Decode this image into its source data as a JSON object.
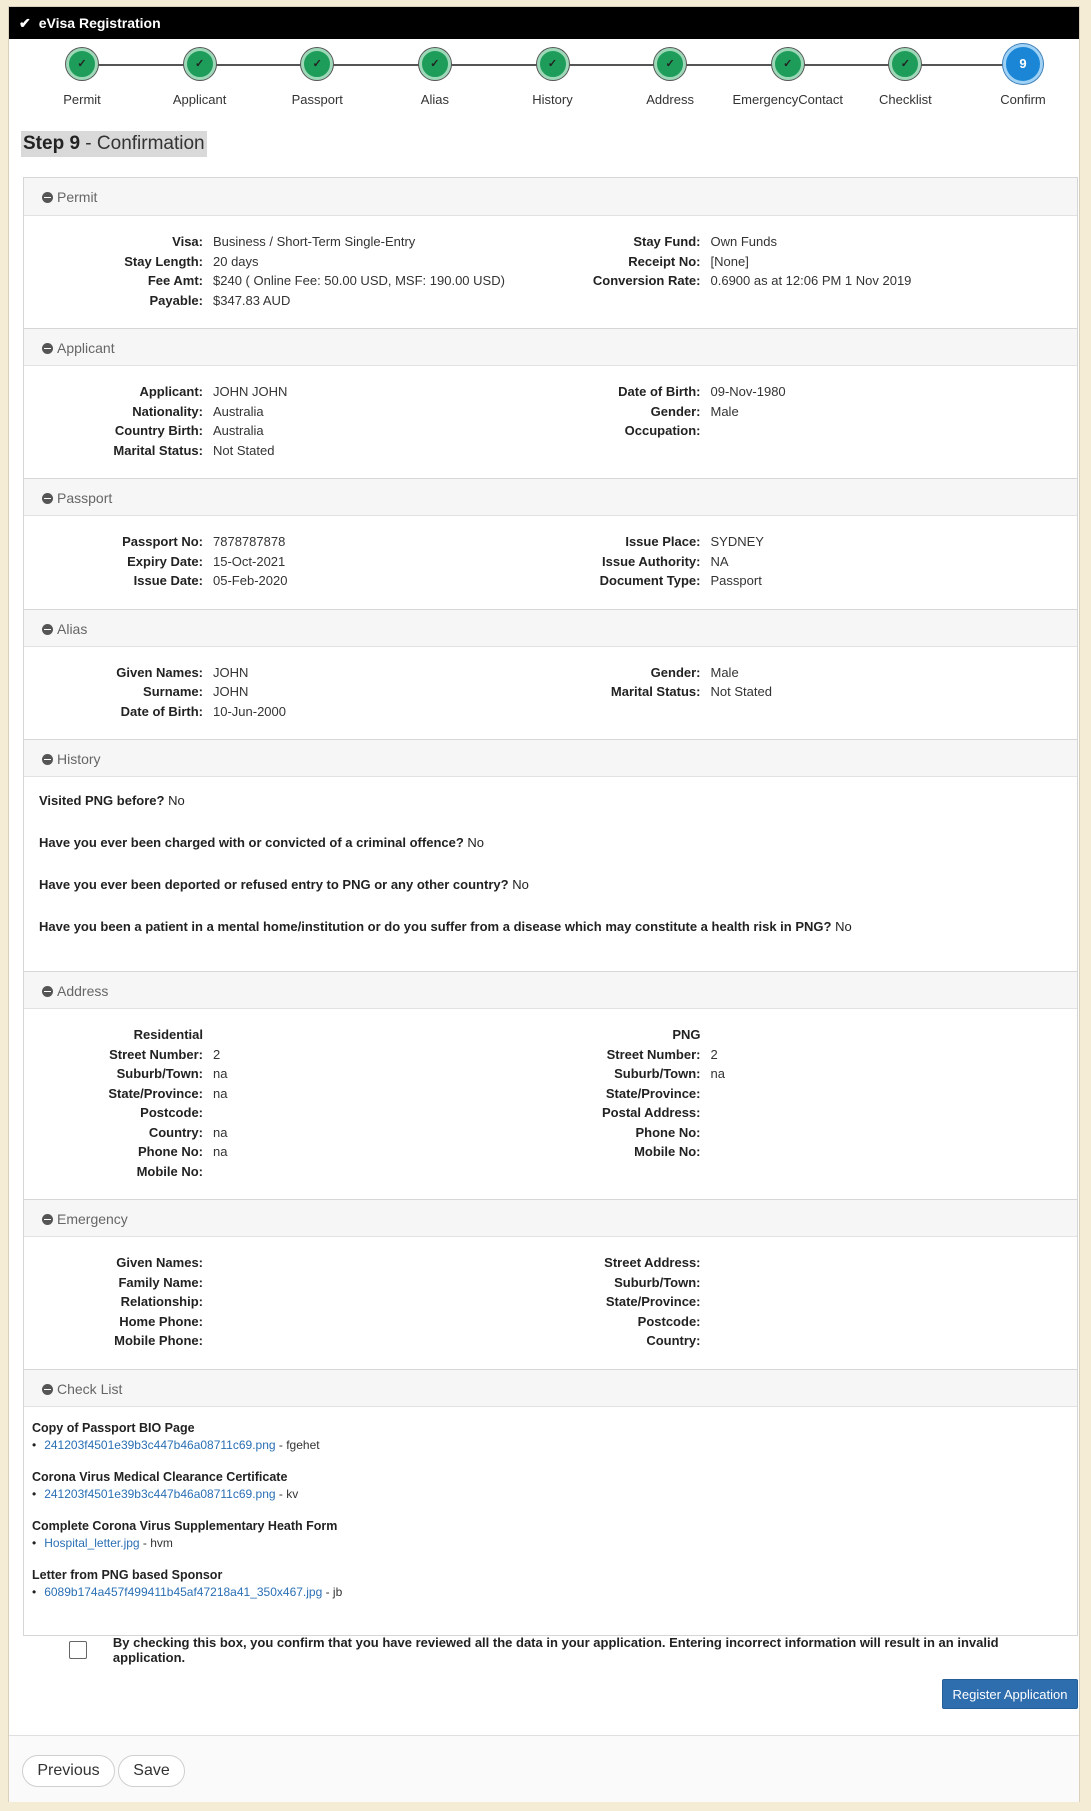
{
  "window": {
    "title": "eVisa Registration"
  },
  "stepper": {
    "steps": [
      "Permit",
      "Applicant",
      "Passport",
      "Alias",
      "History",
      "Address",
      "EmergencyContact",
      "Checklist",
      "Confirm"
    ],
    "current_number": "9",
    "check_glyph": "✓"
  },
  "step_heading": {
    "prefix": "Step 9",
    "title": " - Confirmation"
  },
  "permit": {
    "title": "Permit",
    "left": [
      {
        "k": "Visa:",
        "v": "Business / Short-Term Single-Entry"
      },
      {
        "k": "Stay Length:",
        "v": "20 days"
      },
      {
        "k": "Fee Amt:",
        "v": "$240 ( Online Fee: 50.00 USD, MSF: 190.00 USD)"
      },
      {
        "k": "Payable:",
        "v": "$347.83 AUD"
      }
    ],
    "right": [
      {
        "k": "Stay Fund:",
        "v": "Own Funds"
      },
      {
        "k": "Receipt No:",
        "v": "[None]"
      },
      {
        "k": "Conversion Rate:",
        "v": "0.6900 as at 12:06 PM 1 Nov 2019"
      }
    ]
  },
  "applicant": {
    "title": "Applicant",
    "left": [
      {
        "k": "Applicant:",
        "v": "JOHN JOHN"
      },
      {
        "k": "Nationality:",
        "v": "Australia"
      },
      {
        "k": "Country Birth:",
        "v": "Australia"
      },
      {
        "k": "Marital Status:",
        "v": "Not Stated"
      }
    ],
    "right": [
      {
        "k": "Date of Birth:",
        "v": "09-Nov-1980"
      },
      {
        "k": "Gender:",
        "v": "Male"
      },
      {
        "k": "Occupation:",
        "v": ""
      }
    ]
  },
  "passport": {
    "title": "Passport",
    "left": [
      {
        "k": "Passport No:",
        "v": "7878787878"
      },
      {
        "k": "Expiry Date:",
        "v": "15-Oct-2021"
      },
      {
        "k": "Issue Date:",
        "v": "05-Feb-2020"
      }
    ],
    "right": [
      {
        "k": "Issue Place:",
        "v": "SYDNEY"
      },
      {
        "k": "Issue Authority:",
        "v": "NA"
      },
      {
        "k": "Document Type:",
        "v": "Passport"
      }
    ]
  },
  "alias": {
    "title": "Alias",
    "left": [
      {
        "k": "Given Names:",
        "v": "JOHN"
      },
      {
        "k": "Surname:",
        "v": "JOHN"
      },
      {
        "k": "Date of Birth:",
        "v": "10-Jun-2000"
      }
    ],
    "right": [
      {
        "k": "Gender:",
        "v": "Male"
      },
      {
        "k": "Marital Status:",
        "v": "Not Stated"
      }
    ]
  },
  "history": {
    "title": "History",
    "items": [
      {
        "q": "Visited PNG before?",
        "a": "No"
      },
      {
        "q": "Have you ever been charged with or convicted of a criminal offence?",
        "a": "No"
      },
      {
        "q": "Have you ever been deported or refused entry to PNG or any other country?",
        "a": "No"
      },
      {
        "q": "Have you been a patient in a mental home/institution or do you suffer from a disease which may constitute a health risk in PNG?",
        "a": "No"
      }
    ]
  },
  "address": {
    "title": "Address",
    "left": [
      {
        "k": "Residential",
        "v": ""
      },
      {
        "k": "Street Number:",
        "v": "2"
      },
      {
        "k": "Suburb/Town:",
        "v": "na"
      },
      {
        "k": "State/Province:",
        "v": "na"
      },
      {
        "k": "Postcode:",
        "v": ""
      },
      {
        "k": "Country:",
        "v": "na"
      },
      {
        "k": "Phone No:",
        "v": "na"
      },
      {
        "k": "Mobile No:",
        "v": ""
      }
    ],
    "right": [
      {
        "k": "PNG",
        "v": ""
      },
      {
        "k": "Street Number:",
        "v": "2"
      },
      {
        "k": "Suburb/Town:",
        "v": "na"
      },
      {
        "k": "State/Province:",
        "v": ""
      },
      {
        "k": "Postal Address:",
        "v": ""
      },
      {
        "k": "Phone No:",
        "v": ""
      },
      {
        "k": "Mobile No:",
        "v": ""
      }
    ]
  },
  "emergency": {
    "title": "Emergency",
    "left": [
      {
        "k": "Given Names:",
        "v": ""
      },
      {
        "k": "Family Name:",
        "v": ""
      },
      {
        "k": "Relationship:",
        "v": ""
      },
      {
        "k": "Home Phone:",
        "v": ""
      },
      {
        "k": "Mobile Phone:",
        "v": ""
      }
    ],
    "right": [
      {
        "k": "Street Address:",
        "v": ""
      },
      {
        "k": "Suburb/Town:",
        "v": ""
      },
      {
        "k": "State/Province:",
        "v": ""
      },
      {
        "k": "Postcode:",
        "v": ""
      },
      {
        "k": "Country:",
        "v": ""
      }
    ]
  },
  "checklist": {
    "title": "Check List",
    "items": [
      {
        "title": "Copy of Passport BIO Page",
        "file": "241203f4501e39b3c447b46a08711c69.png",
        "by": " - fgehet"
      },
      {
        "title": "Corona Virus Medical Clearance Certificate",
        "file": "241203f4501e39b3c447b46a08711c69.png",
        "by": " - kv"
      },
      {
        "title": "Complete Corona Virus Supplementary Heath Form",
        "file": "Hospital_letter.jpg",
        "by": " - hvm"
      },
      {
        "title": "Letter from PNG based Sponsor",
        "file": "6089b174a457f499411b45af47218a41_350x467.jpg",
        "by": " - jb"
      }
    ]
  },
  "confirm": {
    "text": "By checking this box, you confirm that you have reviewed all the data in your application. Entering incorrect information will result in an invalid application.",
    "checked": false
  },
  "buttons": {
    "register": "Register Application",
    "previous": "Previous",
    "save": "Save"
  }
}
